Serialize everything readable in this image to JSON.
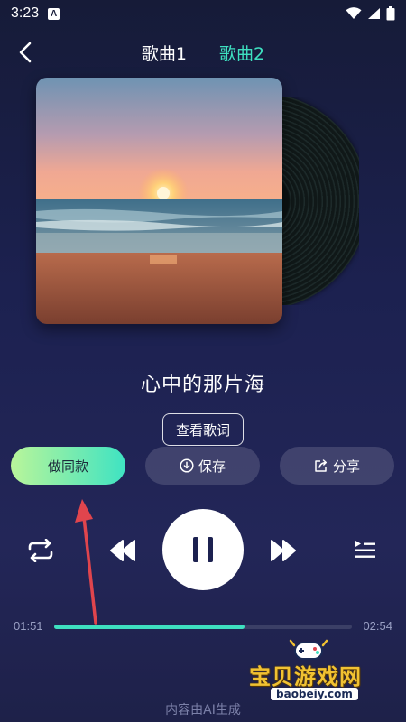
{
  "status_bar": {
    "time": "3:23",
    "app_badge": "A"
  },
  "header": {
    "tabs": [
      {
        "label": "歌曲1",
        "active": false
      },
      {
        "label": "歌曲2",
        "active": true
      }
    ]
  },
  "song": {
    "title": "心中的那片海"
  },
  "buttons": {
    "lyrics": "查看歌词",
    "make_same": "做同款",
    "save": "保存",
    "share": "分享"
  },
  "playback": {
    "current_time": "01:51",
    "total_time": "02:54",
    "progress": 0.64,
    "state": "playing"
  },
  "watermark": {
    "text": "宝贝游戏网",
    "url": "baobeiy.com"
  },
  "footer": {
    "note": "内容由AI生成"
  },
  "colors": {
    "accent": "#3ee0c0",
    "background": "#1c2150",
    "annotation_arrow": "#e0454d"
  }
}
